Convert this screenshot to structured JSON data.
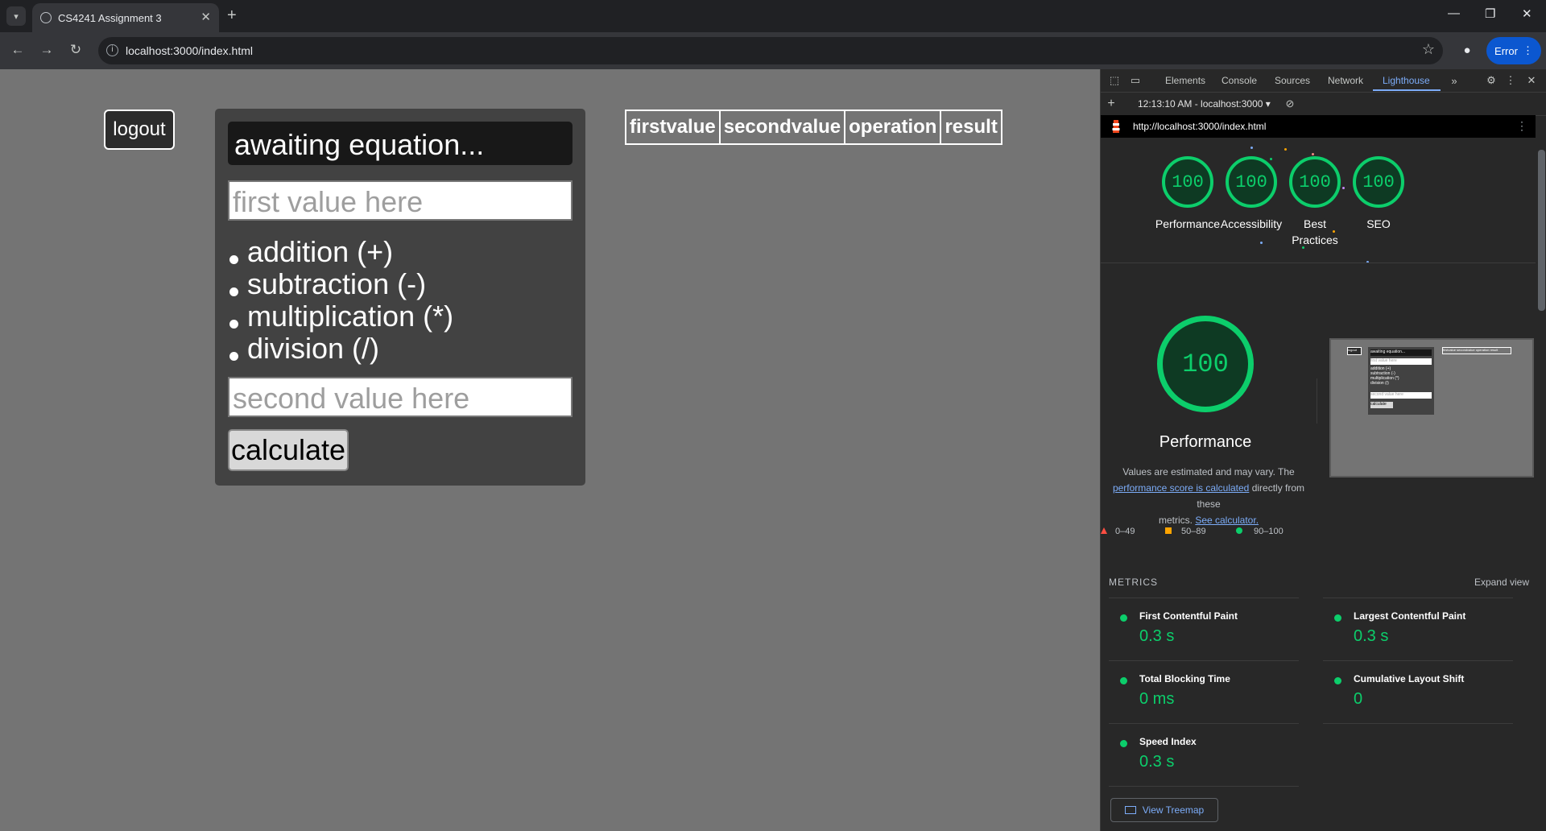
{
  "browser": {
    "tab_title": "CS4241 Assignment 3",
    "url": "localhost:3000/index.html",
    "error_label": "Error"
  },
  "page": {
    "logout_label": "logout",
    "display_text": "awaiting equation...",
    "first_placeholder": "first value here",
    "second_placeholder": "second value here",
    "operations": [
      "addition (+)",
      "subtraction (-)",
      "multiplication (*)",
      "division (/)"
    ],
    "calculate_label": "calculate",
    "table_headers": [
      "firstvalue",
      "secondvalue",
      "operation",
      "result"
    ]
  },
  "devtools": {
    "tabs": [
      "Elements",
      "Console",
      "Sources",
      "Network",
      "Lighthouse"
    ],
    "active_tab": "Lighthouse",
    "report_time": "12:13:10 AM - localhost:3000",
    "report_url": "http://localhost:3000/index.html",
    "scores": [
      {
        "label": "Performance",
        "score": "100"
      },
      {
        "label": "Accessibility",
        "score": "100"
      },
      {
        "label": "Best\nPractices",
        "score": "100"
      },
      {
        "label": "SEO",
        "score": "100"
      }
    ],
    "performance": {
      "score": "100",
      "title": "Performance",
      "note_1": "Values are estimated and may vary. The",
      "note_link_1": "performance score is calculated",
      "note_2": "directly from these",
      "note_3": "metrics.",
      "note_link_2": "See calculator."
    },
    "legend": [
      "0–49",
      "50–89",
      "90–100"
    ],
    "colors": {
      "pass": "#0cce6b",
      "average": "#ffa400",
      "fail": "#ff4e42"
    },
    "metrics_heading": "METRICS",
    "expand_label": "Expand view",
    "metrics": [
      {
        "name": "First Contentful Paint",
        "value": "0.3 s"
      },
      {
        "name": "Largest Contentful Paint",
        "value": "0.3 s"
      },
      {
        "name": "Total Blocking Time",
        "value": "0 ms"
      },
      {
        "name": "Cumulative Layout Shift",
        "value": "0"
      },
      {
        "name": "Speed Index",
        "value": "0.3 s"
      }
    ],
    "treemap_label": "View Treemap",
    "thumbnail": {
      "display_text": "awaiting equation...",
      "first_placeholder": "first value here",
      "operations": [
        "addition (+)",
        "subtraction (-)",
        "multiplication (*)",
        "division (/)"
      ],
      "second_placeholder": "second value here",
      "calculate_label": "calculate",
      "table_headers": "firstvalue secondvalue operation result",
      "logout_label": "logout"
    }
  }
}
